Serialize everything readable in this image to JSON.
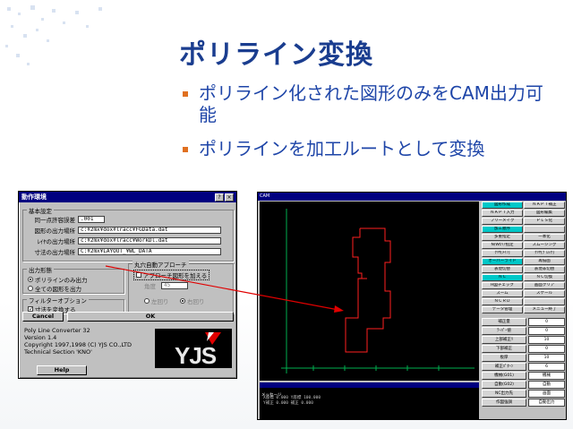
{
  "slide": {
    "title": "ポリライン変換",
    "bullets": [
      "ポリライン化された図形のみをCAM出力可能",
      "ポリラインを加工ルートとして変換"
    ],
    "colors": {
      "title": "#1a3d8f",
      "bullet_text": "#1e45a8",
      "bullet_marker": "#e07020",
      "arrow": "#e00000"
    }
  },
  "dialog": {
    "title": "動作環境",
    "basic_group": "基本設定",
    "fields": [
      {
        "label": "同一点許容誤差",
        "value": ".001"
      },
      {
        "label": "図形の出力場所",
        "value": "c:¥2mx¥dox¥lracc¥FGData.dat"
      },
      {
        "label": "ﾚｲﾔの出力場所",
        "value": "c:¥2mx¥dox¥lracc¥WorkDl.dat"
      },
      {
        "label": "寸法の出力場所",
        "value": "C:¥2mx¥LAYOUT_¥WL_DATA"
      }
    ],
    "output_group": "出力形態",
    "output_options": [
      "ポリラインのみ出力",
      "全ての図形を出力"
    ],
    "filter_group": "フィルターオプション",
    "filter_option": "寸法を変換する",
    "approach_group": "丸穴自動アプローチ",
    "approach_check": "アプローチ図形を加える",
    "angle_label": "角度",
    "angle_value": "45",
    "direction_options": [
      "左回り",
      "右回り"
    ],
    "cancel_label": "Cancel",
    "ok_label": "OK",
    "help_label": "Help",
    "info_lines": [
      "Poly Line Converter 32",
      "Version 1.4",
      "Copyright 1997,1998 (C) YJS CO.,LTD",
      "Technical Section 'KNO'"
    ],
    "logo_text": "YJS"
  },
  "cam": {
    "window_title": "CAM",
    "panel_buttons": [
      [
        "図形作成",
        "ＮＡＰＴ補正"
      ],
      [
        "ＮＡＰＴ入力",
        "図形編集"
      ],
      [
        "フリーメイク",
        "ＰＬＳ化"
      ],
      [
        "加工順序",
        ""
      ],
      [
        "多重指定",
        "一本化"
      ],
      [
        "N/Wｴﾘｱ指定",
        "スムージング"
      ],
      [
        "ｸﾘﾔ[ﾒｲﾝ]",
        "ｸﾘﾔ[ﾌﾞﾛｯｸ]"
      ],
      [
        "オーバーライド",
        "再描画"
      ],
      [
        "表現切替",
        "表現非切替"
      ],
      [
        "ＮＣ",
        "ＮＣ切換"
      ],
      [
        "H図チェック",
        "画面クリア"
      ],
      [
        "ズーム",
        "スケール"
      ],
      [
        "ＮＣＲＤ",
        ""
      ],
      [
        "データ管理",
        "メニュー終了"
      ]
    ],
    "param_rows": [
      [
        "補正量",
        "0"
      ],
      [
        "ﾃｰﾊﾟｰ値",
        "0"
      ],
      [
        "上部補正ﾘ",
        "10"
      ],
      [
        "下部補正",
        "0"
      ],
      [
        "板厚",
        "10"
      ],
      [
        "補正ﾊﾟﾀｰﾝ",
        "6"
      ],
      [
        "機械(G01)",
        "機械"
      ],
      [
        "自動(G02)",
        "自動"
      ],
      [
        "NC出力先",
        "画面"
      ],
      [
        "作図強調",
        "自動出力"
      ]
    ],
    "message_title": "メッセージ",
    "message_lines": [
      "X座標       0.000    Y座標   100.000",
      "Y補正        0.000      補正       0.000"
    ]
  }
}
